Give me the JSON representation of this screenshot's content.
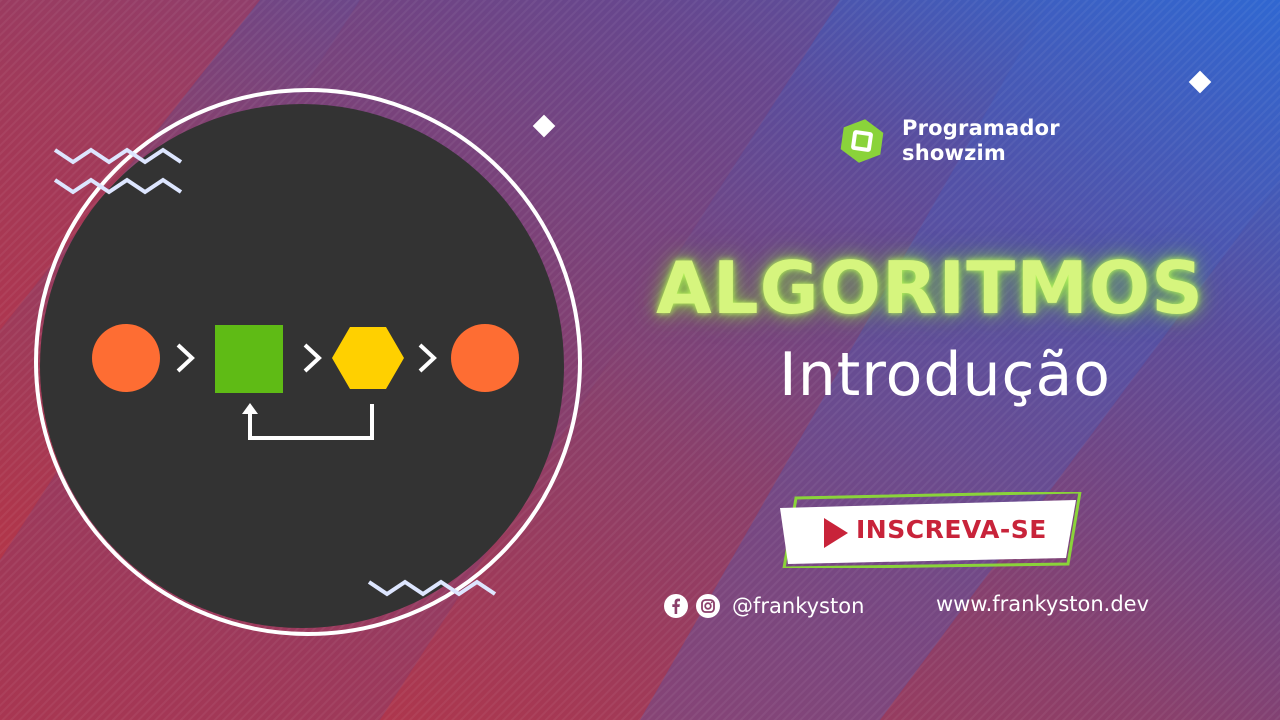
{
  "brand": {
    "name_line1": "Programador",
    "name_line2": "showzim",
    "logo_icon": "green-hexagon-logo-icon",
    "accent_color": "#8ad33a"
  },
  "title": "ALGORITMOS",
  "subtitle": "Introdução",
  "cta": {
    "label": "INSCREVA-SE",
    "icon": "play-triangle-icon",
    "label_color": "#c8233a"
  },
  "social": {
    "icons": [
      "facebook-icon",
      "instagram-icon"
    ],
    "handle": "@frankyston"
  },
  "website": "www.frankyston.dev",
  "diagram": {
    "shapes": [
      "circle",
      "square",
      "hexagon",
      "circle"
    ],
    "colors": {
      "circle": "#fe6d33",
      "square": "#5fbb15",
      "hexagon": "#ffd000",
      "panel": "#333333"
    }
  },
  "colors": {
    "background_left": "#c83a48",
    "background_right": "#3a6fd8",
    "title_glow": "#d6f57e"
  }
}
